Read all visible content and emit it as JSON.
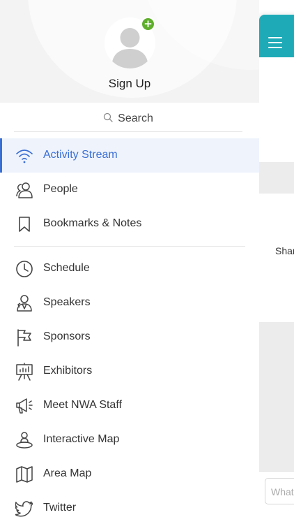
{
  "header": {
    "signup_label": "Sign Up",
    "avatar_icon": "user-avatar-icon",
    "badge_symbol": "+",
    "badge_color": "#5fae2c"
  },
  "search": {
    "label": "Search",
    "icon": "search-icon"
  },
  "menu": {
    "active_color": "#3a6fd4",
    "group1": [
      {
        "label": "Activity Stream",
        "icon": "wifi-icon",
        "active": true
      },
      {
        "label": "People",
        "icon": "people-icon",
        "active": false
      },
      {
        "label": "Bookmarks & Notes",
        "icon": "bookmark-icon",
        "active": false
      }
    ],
    "group2": [
      {
        "label": "Schedule",
        "icon": "clock-icon"
      },
      {
        "label": "Speakers",
        "icon": "speakers-icon"
      },
      {
        "label": "Sponsors",
        "icon": "flag-icon"
      },
      {
        "label": "Exhibitors",
        "icon": "easel-icon"
      },
      {
        "label": "Meet NWA Staff",
        "icon": "megaphone-icon"
      },
      {
        "label": "Interactive Map",
        "icon": "map-pin-person-icon"
      },
      {
        "label": "Area Map",
        "icon": "folded-map-icon"
      },
      {
        "label": "Twitter",
        "icon": "twitter-icon"
      }
    ]
  },
  "app_panel": {
    "topbar_color": "#1eabb7",
    "share_text": "Shar",
    "input_placeholder": "What"
  }
}
